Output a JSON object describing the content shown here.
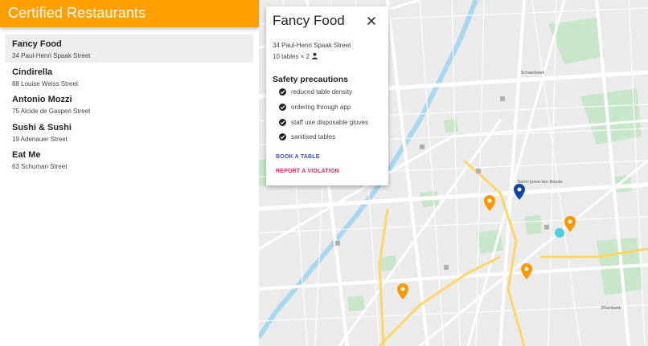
{
  "app": {
    "title": "Certified Restaurants"
  },
  "restaurants": [
    {
      "name": "Fancy Food",
      "address": "34 Paul-Henri Spaak Street"
    },
    {
      "name": "Cindirella",
      "address": "88 Louise Weiss Street"
    },
    {
      "name": "Antonio Mozzi",
      "address": "75 Alcide de Gasperi Street"
    },
    {
      "name": "Sushi & Sushi",
      "address": "19 Adenauer Street"
    },
    {
      "name": "Eat Me",
      "address": "63 Schuman Street"
    }
  ],
  "selected_index": 0,
  "popup": {
    "title": "Fancy Food",
    "address": "34 Paul-Henri Spaak Street",
    "tables": "10 tables × 2",
    "section_title": "Safety precautions",
    "precautions": [
      "reduced table density",
      "ordering through app",
      "staff use disposable gloves",
      "sanitised tables"
    ],
    "book_label": "BOOK A TABLE",
    "report_label": "REPORT A VIOLATION"
  },
  "map": {
    "labels": {
      "top_right": "Schaerbeek",
      "center": "Saint-Josse-ten-Noode",
      "bottom_right": "Etterbeek"
    }
  },
  "colors": {
    "appbar": "#ffa000",
    "book": "#3f51b5",
    "report": "#e91e63",
    "pin_orange": "#ff9800",
    "pin_blue": "#0d47a1"
  },
  "icons": {
    "close": "close-icon",
    "person": "person-icon",
    "check": "check-circle-icon",
    "pin": "map-pin-icon"
  }
}
